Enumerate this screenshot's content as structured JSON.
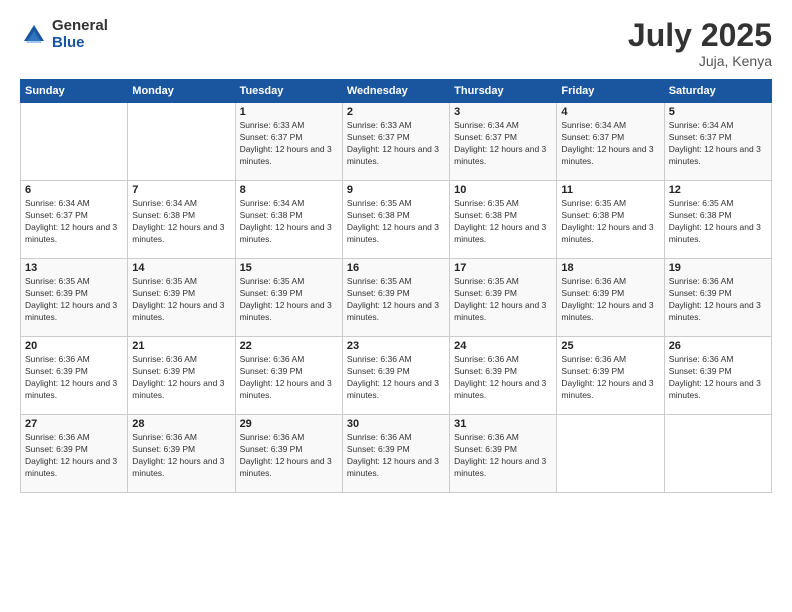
{
  "logo": {
    "general": "General",
    "blue": "Blue"
  },
  "header": {
    "month_year": "July 2025",
    "location": "Juja, Kenya"
  },
  "weekdays": [
    "Sunday",
    "Monday",
    "Tuesday",
    "Wednesday",
    "Thursday",
    "Friday",
    "Saturday"
  ],
  "weeks": [
    [
      {
        "day": "",
        "info": ""
      },
      {
        "day": "",
        "info": ""
      },
      {
        "day": "1",
        "info": "Sunrise: 6:33 AM\nSunset: 6:37 PM\nDaylight: 12 hours and 3 minutes."
      },
      {
        "day": "2",
        "info": "Sunrise: 6:33 AM\nSunset: 6:37 PM\nDaylight: 12 hours and 3 minutes."
      },
      {
        "day": "3",
        "info": "Sunrise: 6:34 AM\nSunset: 6:37 PM\nDaylight: 12 hours and 3 minutes."
      },
      {
        "day": "4",
        "info": "Sunrise: 6:34 AM\nSunset: 6:37 PM\nDaylight: 12 hours and 3 minutes."
      },
      {
        "day": "5",
        "info": "Sunrise: 6:34 AM\nSunset: 6:37 PM\nDaylight: 12 hours and 3 minutes."
      }
    ],
    [
      {
        "day": "6",
        "info": "Sunrise: 6:34 AM\nSunset: 6:37 PM\nDaylight: 12 hours and 3 minutes."
      },
      {
        "day": "7",
        "info": "Sunrise: 6:34 AM\nSunset: 6:38 PM\nDaylight: 12 hours and 3 minutes."
      },
      {
        "day": "8",
        "info": "Sunrise: 6:34 AM\nSunset: 6:38 PM\nDaylight: 12 hours and 3 minutes."
      },
      {
        "day": "9",
        "info": "Sunrise: 6:35 AM\nSunset: 6:38 PM\nDaylight: 12 hours and 3 minutes."
      },
      {
        "day": "10",
        "info": "Sunrise: 6:35 AM\nSunset: 6:38 PM\nDaylight: 12 hours and 3 minutes."
      },
      {
        "day": "11",
        "info": "Sunrise: 6:35 AM\nSunset: 6:38 PM\nDaylight: 12 hours and 3 minutes."
      },
      {
        "day": "12",
        "info": "Sunrise: 6:35 AM\nSunset: 6:38 PM\nDaylight: 12 hours and 3 minutes."
      }
    ],
    [
      {
        "day": "13",
        "info": "Sunrise: 6:35 AM\nSunset: 6:39 PM\nDaylight: 12 hours and 3 minutes."
      },
      {
        "day": "14",
        "info": "Sunrise: 6:35 AM\nSunset: 6:39 PM\nDaylight: 12 hours and 3 minutes."
      },
      {
        "day": "15",
        "info": "Sunrise: 6:35 AM\nSunset: 6:39 PM\nDaylight: 12 hours and 3 minutes."
      },
      {
        "day": "16",
        "info": "Sunrise: 6:35 AM\nSunset: 6:39 PM\nDaylight: 12 hours and 3 minutes."
      },
      {
        "day": "17",
        "info": "Sunrise: 6:35 AM\nSunset: 6:39 PM\nDaylight: 12 hours and 3 minutes."
      },
      {
        "day": "18",
        "info": "Sunrise: 6:36 AM\nSunset: 6:39 PM\nDaylight: 12 hours and 3 minutes."
      },
      {
        "day": "19",
        "info": "Sunrise: 6:36 AM\nSunset: 6:39 PM\nDaylight: 12 hours and 3 minutes."
      }
    ],
    [
      {
        "day": "20",
        "info": "Sunrise: 6:36 AM\nSunset: 6:39 PM\nDaylight: 12 hours and 3 minutes."
      },
      {
        "day": "21",
        "info": "Sunrise: 6:36 AM\nSunset: 6:39 PM\nDaylight: 12 hours and 3 minutes."
      },
      {
        "day": "22",
        "info": "Sunrise: 6:36 AM\nSunset: 6:39 PM\nDaylight: 12 hours and 3 minutes."
      },
      {
        "day": "23",
        "info": "Sunrise: 6:36 AM\nSunset: 6:39 PM\nDaylight: 12 hours and 3 minutes."
      },
      {
        "day": "24",
        "info": "Sunrise: 6:36 AM\nSunset: 6:39 PM\nDaylight: 12 hours and 3 minutes."
      },
      {
        "day": "25",
        "info": "Sunrise: 6:36 AM\nSunset: 6:39 PM\nDaylight: 12 hours and 3 minutes."
      },
      {
        "day": "26",
        "info": "Sunrise: 6:36 AM\nSunset: 6:39 PM\nDaylight: 12 hours and 3 minutes."
      }
    ],
    [
      {
        "day": "27",
        "info": "Sunrise: 6:36 AM\nSunset: 6:39 PM\nDaylight: 12 hours and 3 minutes."
      },
      {
        "day": "28",
        "info": "Sunrise: 6:36 AM\nSunset: 6:39 PM\nDaylight: 12 hours and 3 minutes."
      },
      {
        "day": "29",
        "info": "Sunrise: 6:36 AM\nSunset: 6:39 PM\nDaylight: 12 hours and 3 minutes."
      },
      {
        "day": "30",
        "info": "Sunrise: 6:36 AM\nSunset: 6:39 PM\nDaylight: 12 hours and 3 minutes."
      },
      {
        "day": "31",
        "info": "Sunrise: 6:36 AM\nSunset: 6:39 PM\nDaylight: 12 hours and 3 minutes."
      },
      {
        "day": "",
        "info": ""
      },
      {
        "day": "",
        "info": ""
      }
    ]
  ]
}
